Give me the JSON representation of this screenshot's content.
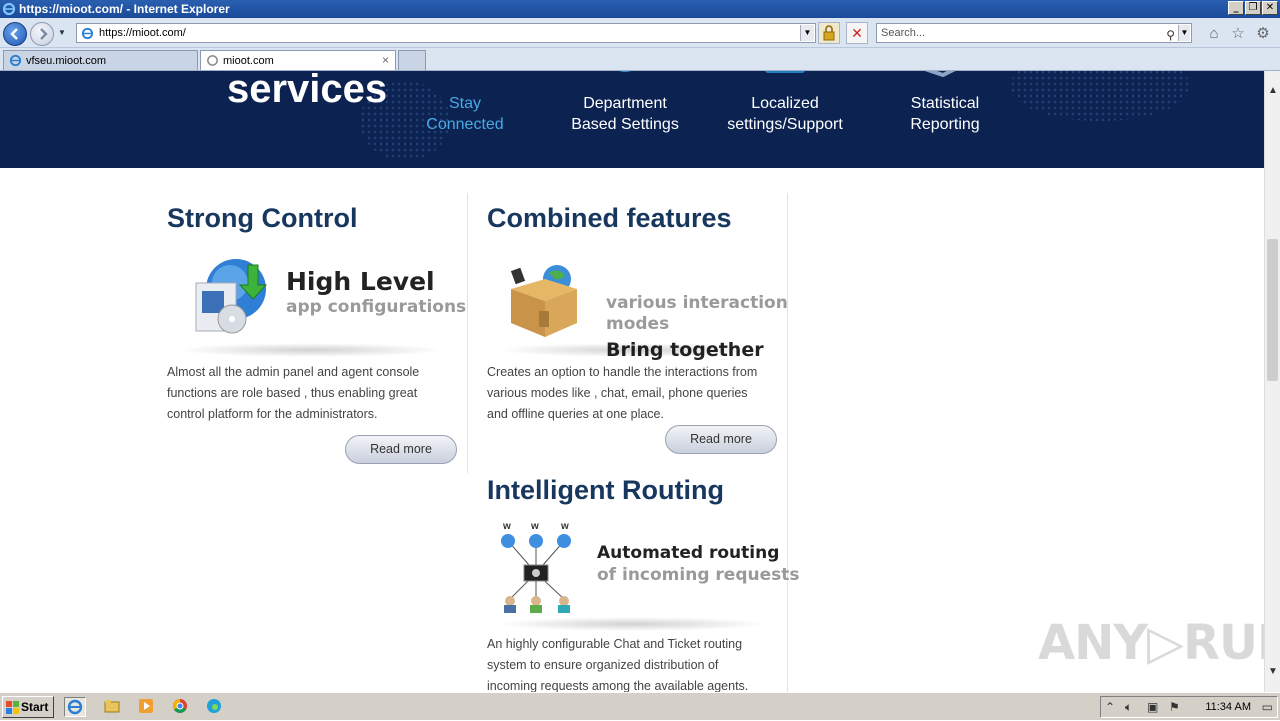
{
  "window": {
    "title": "https://mioot.com/ - Internet Explorer",
    "buttons": {
      "minimize": "_",
      "restore": "❐",
      "close": "✕"
    }
  },
  "navbar": {
    "address": "https://mioot.com/",
    "search_placeholder": "Search..."
  },
  "tabs": [
    {
      "label": "vfseu.mioot.com"
    },
    {
      "label": "mioot.com",
      "close": "×"
    },
    {
      "label": ""
    }
  ],
  "hero": {
    "title": "services",
    "features": [
      {
        "line1": "Stay",
        "line2": "Connected"
      },
      {
        "line1": "Department",
        "line2": "Based Settings"
      },
      {
        "line1": "Localized",
        "line2": "settings/Support"
      },
      {
        "line1": "Statistical",
        "line2": "Reporting"
      }
    ]
  },
  "sections": {
    "strong_control": {
      "heading": "Strong Control",
      "tag_strong": "High Level",
      "tag_weak": "app configurations",
      "body_lines": [
        "Almost all the admin panel and agent console",
        "functions are role based , thus enabling great",
        "control platform for the administrators."
      ],
      "button": "Read more"
    },
    "combined": {
      "heading": "Combined features",
      "tag_strong": "Bring together",
      "tag_weak_1": "various interaction",
      "tag_weak_2": "modes",
      "body_lines": [
        "Creates an option to handle the interactions from",
        "various modes like , chat, email, phone queries",
        "and offline queries at one place."
      ],
      "button": "Read more"
    },
    "routing": {
      "heading": "Intelligent Routing",
      "tag_strong": "Automated routing",
      "tag_weak": "of incoming requests",
      "w_labels": [
        "w",
        "w",
        "w"
      ],
      "body_lines": [
        "An highly configurable Chat and Ticket routing",
        "system to ensure organized distribution of",
        "incoming requests among the available agents."
      ]
    }
  },
  "watermark": "ANY▷RUN",
  "taskbar": {
    "start": "Start",
    "clock": "11:34 AM"
  },
  "colors": {
    "hero_bg": "#0c2352",
    "heading": "#17375e",
    "feature_highlight": "#49a9e6"
  }
}
